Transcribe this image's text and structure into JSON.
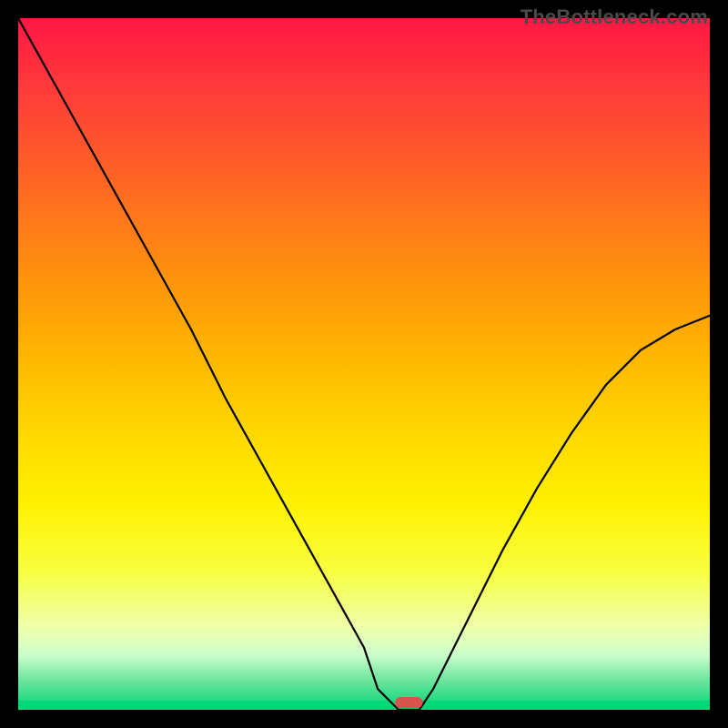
{
  "watermark": "TheBottleneck.com",
  "chart_data": {
    "type": "line",
    "title": "",
    "xlabel": "",
    "ylabel": "",
    "xlim": [
      0,
      100
    ],
    "ylim": [
      0,
      100
    ],
    "grid": false,
    "legend": false,
    "series": [
      {
        "name": "curve",
        "x": [
          0,
          5,
          10,
          15,
          20,
          25,
          30,
          35,
          40,
          45,
          50,
          52,
          55,
          58,
          60,
          65,
          70,
          75,
          80,
          85,
          90,
          95,
          100
        ],
        "values": [
          100,
          91,
          82,
          73,
          64,
          55,
          45,
          36,
          27,
          18,
          9,
          3,
          0,
          0,
          3,
          13,
          23,
          32,
          40,
          47,
          52,
          55,
          57
        ]
      }
    ],
    "minimum_marker": {
      "x": 56.5,
      "width": 4,
      "color": "#d9534f"
    },
    "background_bands": [
      {
        "y": 100,
        "color": "#ff1744"
      },
      {
        "y": 90,
        "color": "#ff3a3a"
      },
      {
        "y": 80,
        "color": "#ff5a2a"
      },
      {
        "y": 70,
        "color": "#ff7a1a"
      },
      {
        "y": 60,
        "color": "#ff9a0a"
      },
      {
        "y": 50,
        "color": "#ffba00"
      },
      {
        "y": 40,
        "color": "#ffd800"
      },
      {
        "y": 30,
        "color": "#fff000"
      },
      {
        "y": 20,
        "color": "#f8ff40"
      },
      {
        "y": 12,
        "color": "#eeffaa"
      },
      {
        "y": 8,
        "color": "#ccffcc"
      },
      {
        "y": 4,
        "color": "#66e29a"
      },
      {
        "y": 0,
        "color": "#00d977"
      }
    ]
  }
}
